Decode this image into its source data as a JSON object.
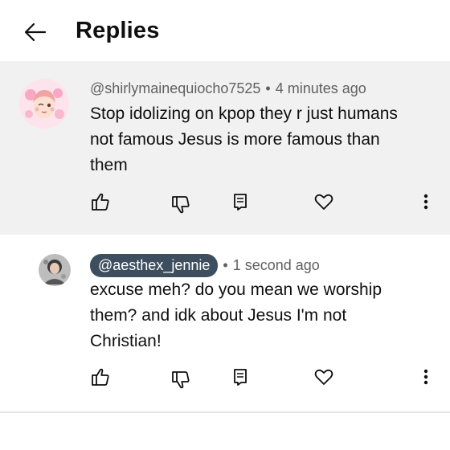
{
  "header": {
    "title": "Replies",
    "back_icon": "arrow-left-icon"
  },
  "comments": [
    {
      "author": "@shirlymainequiocho7525",
      "time": "4 minutes ago",
      "text": "Stop idolizing on kpop they r just humans not famous Jesus is more famous than them",
      "avatar": "anime-girl-avatar"
    },
    {
      "author": "@aesthex_jennie",
      "time": "1 second ago",
      "text": "excuse meh? do you mean we worship them? and idk about Jesus I'm not Christian!",
      "avatar": "user-photo-avatar"
    }
  ],
  "separator": "•",
  "colors": {
    "highlight_bg": "#f1f1f1",
    "chip_bg": "#3d4e5e",
    "meta": "#606060",
    "text": "#0f0f0f"
  }
}
